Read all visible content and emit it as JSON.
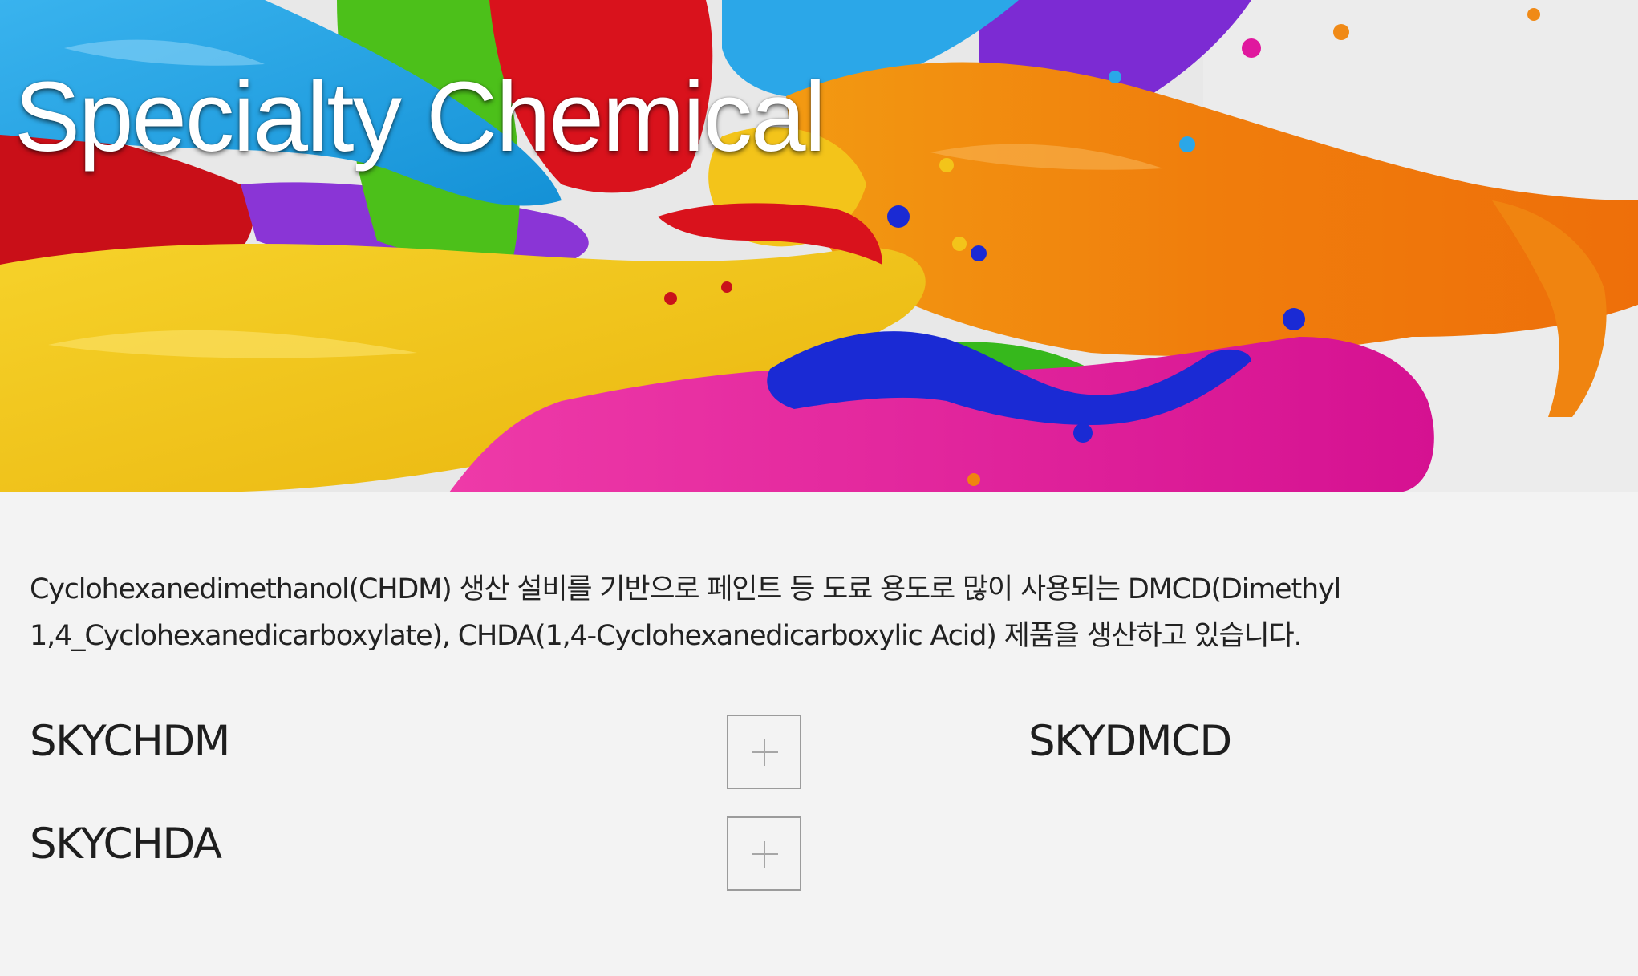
{
  "hero": {
    "title": "Specialty Chemical"
  },
  "intro": {
    "line1": "Cyclohexanedimethanol(CHDM) 생산 설비를 기반으로 페인트 등 도료 용도로 많이 사용되는 DMCD(Dimethyl",
    "line2": "1,4_Cyclohexanedicarboxylate), CHDA(1,4-Cyclohexanedicarboxylic Acid) 제품을 생산하고 있습니다."
  },
  "products": [
    {
      "name": "SKYCHDM",
      "expand_icon": "plus-icon"
    },
    {
      "name": "SKYCHDA",
      "expand_icon": "plus-icon"
    },
    {
      "name": "SKYDMCD"
    }
  ],
  "colors": {
    "background": "#f3f3f3",
    "text": "#222222",
    "button_border": "#9b9b9b",
    "paint_red": "#d8141e",
    "paint_blue": "#1fa0e0",
    "paint_green": "#4fc21c",
    "paint_yellow": "#f2c315",
    "paint_orange": "#f27c0f",
    "paint_magenta": "#e0189e",
    "paint_purple": "#7b2bd1",
    "paint_navy": "#1a2ad4"
  }
}
